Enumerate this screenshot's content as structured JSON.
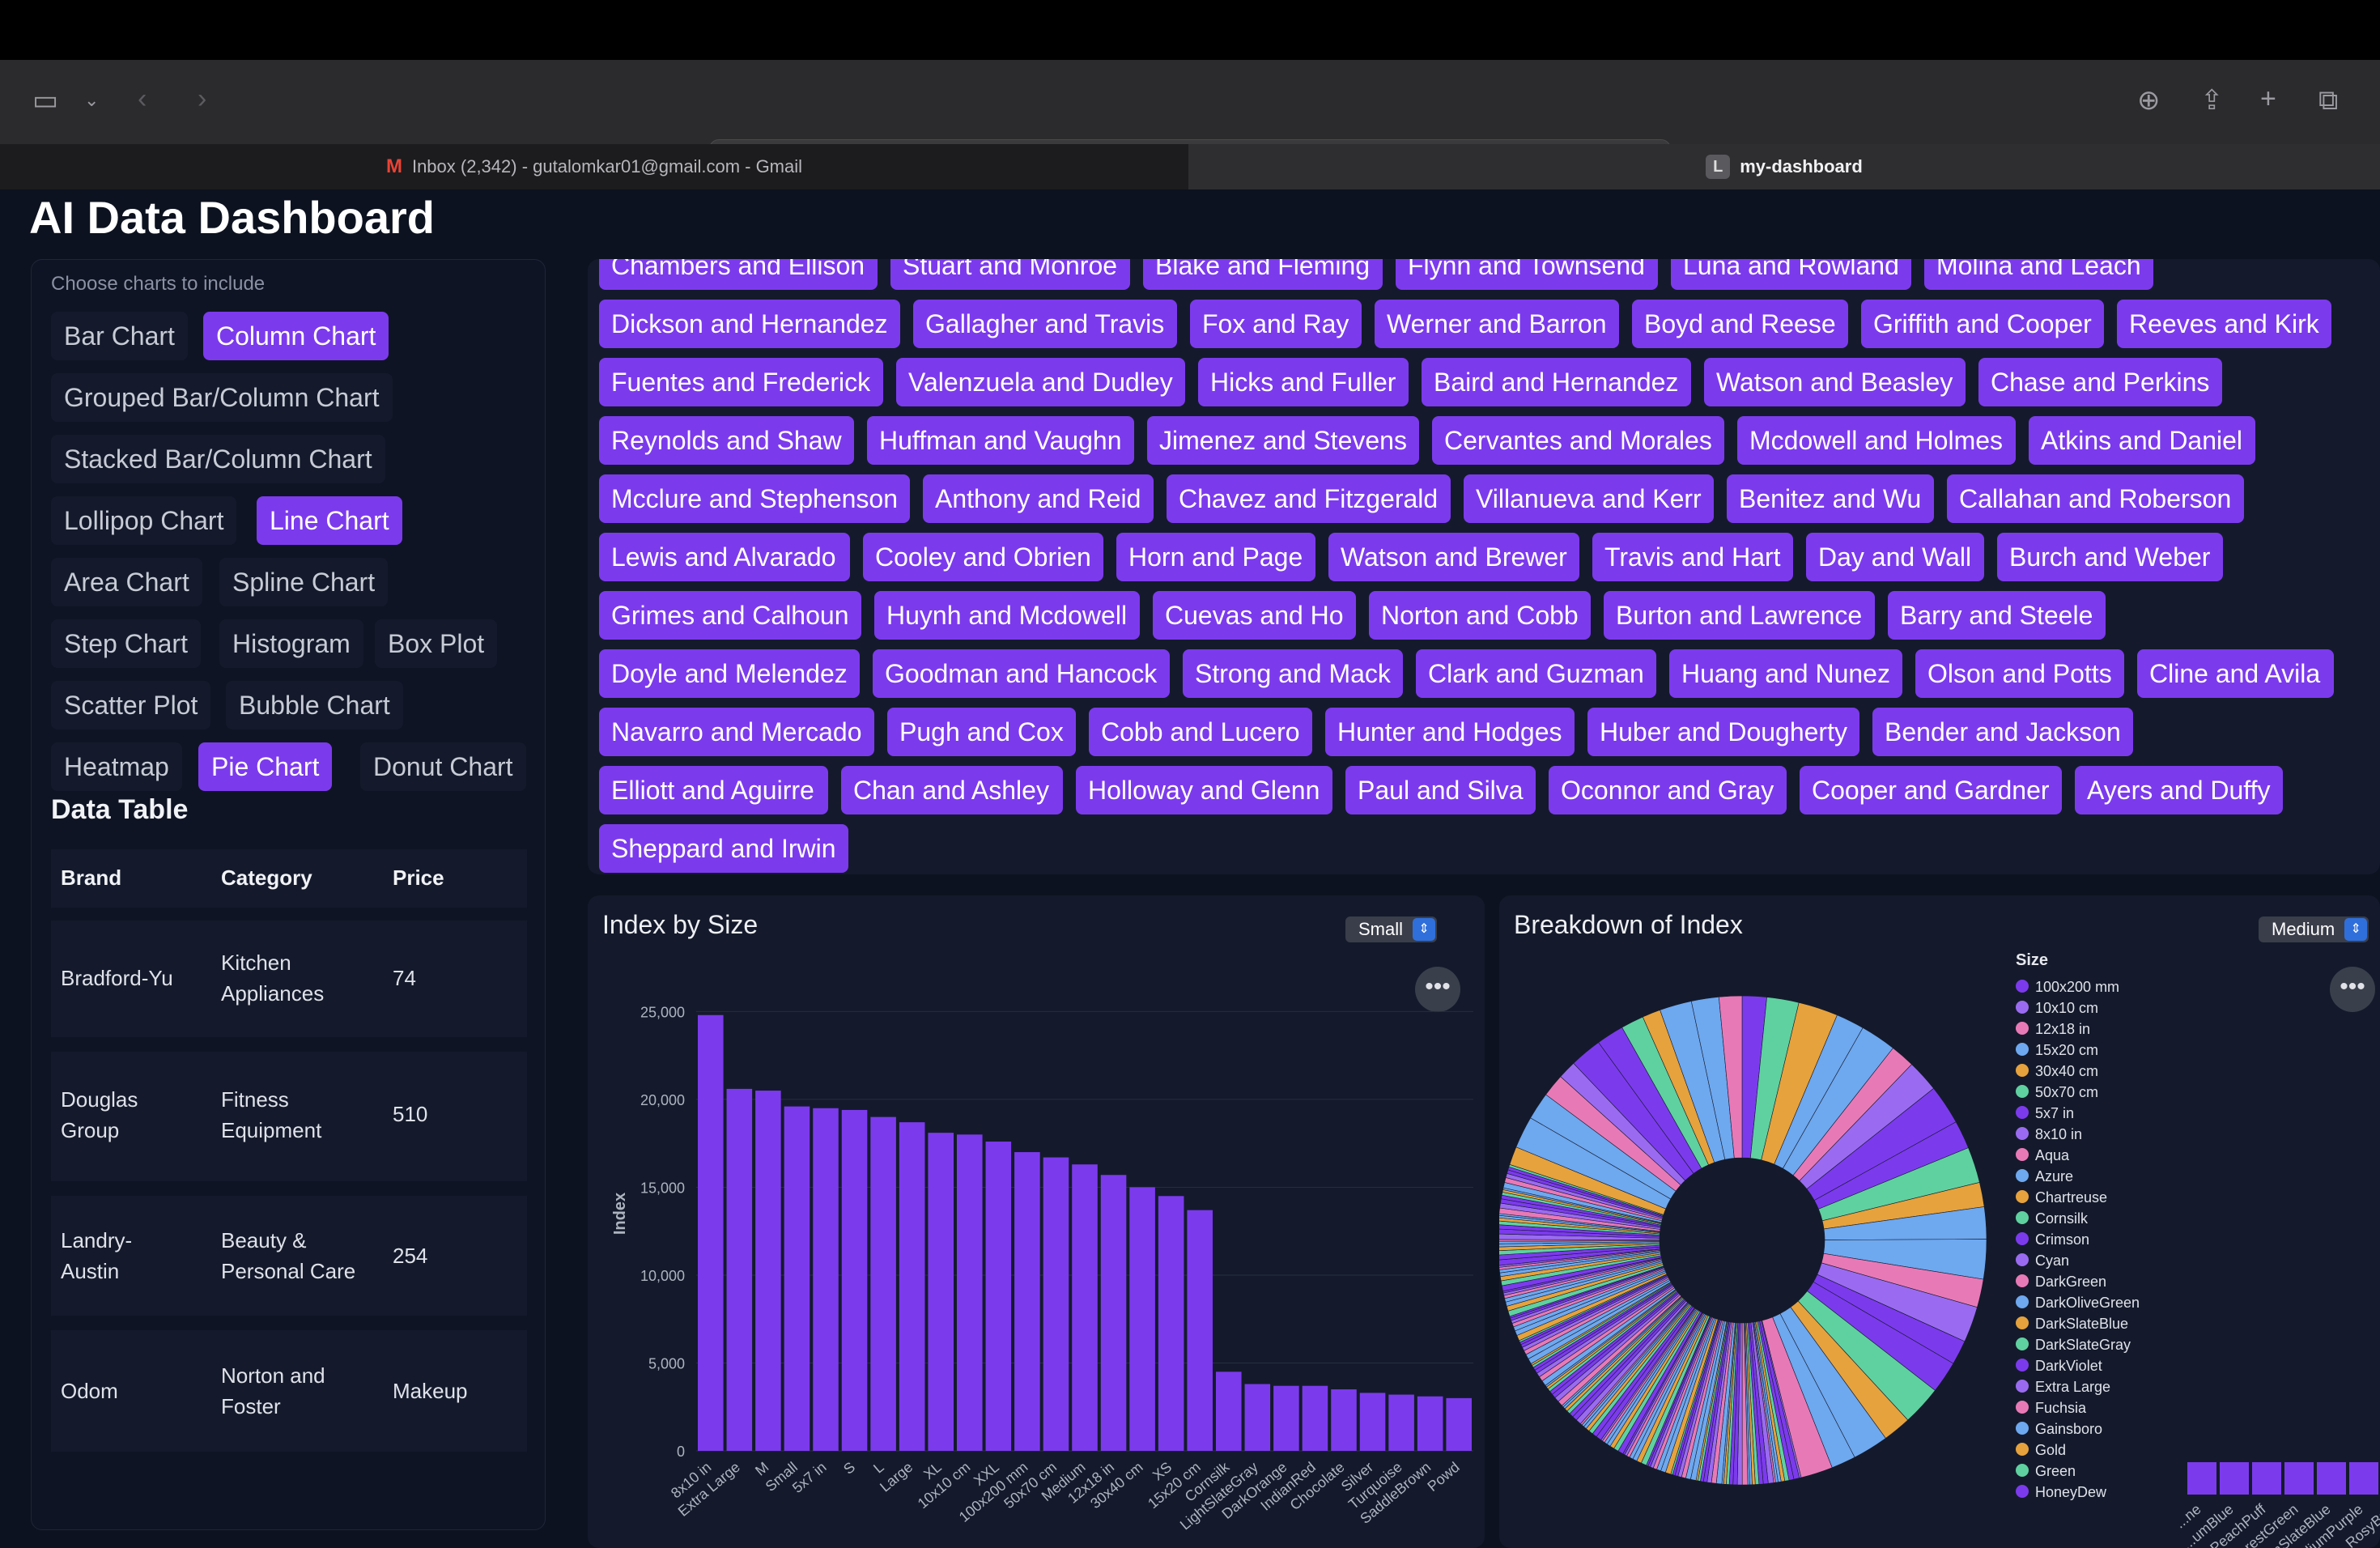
{
  "browser": {
    "url": "localhost",
    "tabs": [
      {
        "label": "Inbox (2,342) - gutalomkar01@gmail.com - Gmail",
        "icon": "gmail-icon"
      },
      {
        "label": "my-dashboard",
        "badge": "L"
      }
    ]
  },
  "page": {
    "title": "AI Data Dashboard",
    "chooser_label": "Choose charts to include"
  },
  "chart_options": [
    {
      "label": "Bar Chart",
      "selected": false
    },
    {
      "label": "Column Chart",
      "selected": true
    },
    {
      "label": "Grouped Bar/Column Chart",
      "selected": false
    },
    {
      "label": "Stacked Bar/Column Chart",
      "selected": false
    },
    {
      "label": "Lollipop Chart",
      "selected": false
    },
    {
      "label": "Line Chart",
      "selected": true
    },
    {
      "label": "Area Chart",
      "selected": false
    },
    {
      "label": "Spline Chart",
      "selected": false
    },
    {
      "label": "Step Chart",
      "selected": false
    },
    {
      "label": "Histogram",
      "selected": false
    },
    {
      "label": "Box Plot",
      "selected": false
    },
    {
      "label": "Scatter Plot",
      "selected": false
    },
    {
      "label": "Bubble Chart",
      "selected": false
    },
    {
      "label": "Heatmap",
      "selected": false
    },
    {
      "label": "Pie Chart",
      "selected": true
    },
    {
      "label": "Donut Chart",
      "selected": false
    }
  ],
  "data_table": {
    "title": "Data Table",
    "headers": [
      "Brand",
      "Category",
      "Price"
    ],
    "rows": [
      [
        "Bradford-Yu",
        "Kitchen Appliances",
        "74"
      ],
      [
        "Douglas Group",
        "Fitness Equipment",
        "510"
      ],
      [
        "Landry-Austin",
        "Beauty & Personal Care",
        "254"
      ],
      [
        "Odom",
        "Norton and Foster",
        "Makeup"
      ]
    ]
  },
  "tags": [
    [
      "Chambers and Ellison",
      "Stuart and Monroe",
      "Blake and Fleming",
      "Flynn and Townsend",
      "Luna and Rowland",
      "Molina and Leach"
    ],
    [
      "Dickson and Hernandez",
      "Gallagher and Travis",
      "Fox and Ray",
      "Werner and Barron",
      "Boyd and Reese",
      "Griffith and Cooper",
      "Reeves and Kirk"
    ],
    [
      "Fuentes and Frederick",
      "Valenzuela and Dudley",
      "Hicks and Fuller",
      "Baird and Hernandez",
      "Watson and Beasley",
      "Chase and Perkins"
    ],
    [
      "Reynolds and Shaw",
      "Huffman and Vaughn",
      "Jimenez and Stevens",
      "Cervantes and Morales",
      "Mcdowell and Holmes",
      "Atkins and Daniel"
    ],
    [
      "Mcclure and Stephenson",
      "Anthony and Reid",
      "Chavez and Fitzgerald",
      "Villanueva and Kerr",
      "Benitez and Wu",
      "Callahan and Roberson"
    ],
    [
      "Lewis and Alvarado",
      "Cooley and Obrien",
      "Horn and Page",
      "Watson and Brewer",
      "Travis and Hart",
      "Day and Wall",
      "Burch and Weber"
    ],
    [
      "Grimes and Calhoun",
      "Huynh and Mcdowell",
      "Cuevas and Ho",
      "Norton and Cobb",
      "Burton and Lawrence",
      "Barry and Steele"
    ],
    [
      "Doyle and Melendez",
      "Goodman and Hancock",
      "Strong and Mack",
      "Clark and Guzman",
      "Huang and Nunez",
      "Olson and Potts",
      "Cline and Avila"
    ],
    [
      "Navarro and Mercado",
      "Pugh and Cox",
      "Cobb and Lucero",
      "Hunter and Hodges",
      "Huber and Dougherty",
      "Bender and Jackson"
    ],
    [
      "Elliott and Aguirre",
      "Chan and Ashley",
      "Holloway and Glenn",
      "Paul and Silva",
      "Oconnor and Gray",
      "Cooper and Gardner",
      "Ayers and Duffy"
    ],
    [
      "Sheppard and Irwin"
    ]
  ],
  "colors": {
    "accent": "#7c3aed",
    "bar": "#7c3aed",
    "pie": [
      "#7c3aed",
      "#9a6bf0",
      "#e879b7",
      "#6ea8ef",
      "#e6a23c",
      "#5fd1a0"
    ]
  },
  "chart_data": [
    {
      "type": "bar",
      "title": "Index by Size",
      "selector": "Small",
      "ylabel": "Index",
      "xlabel": "",
      "ylim": [
        0,
        27000
      ],
      "yticks": [
        "0",
        "5,000",
        "10,000",
        "15,000",
        "20,000",
        "25,000"
      ],
      "categories": [
        "8x10 in",
        "Extra Large",
        "M",
        "Small",
        "5x7 in",
        "S",
        "L",
        "Large",
        "XL",
        "10x10 cm",
        "XXL",
        "100x200 mm",
        "50x70 cm",
        "Medium",
        "12x18 in",
        "30x40 cm",
        "XS",
        "15x20 cm",
        "Cornsilk",
        "LightSlateGray",
        "DarkOrange",
        "IndianRed",
        "Chocolate",
        "Silver",
        "Turquoise",
        "SaddleBrown",
        "Powd"
      ],
      "values": [
        24800,
        20600,
        20500,
        19600,
        19500,
        19400,
        19000,
        18700,
        18100,
        18000,
        17600,
        17000,
        16700,
        16300,
        15700,
        15000,
        14500,
        13700,
        4500,
        3800,
        3700,
        3700,
        3500,
        3300,
        3200,
        3100,
        3000
      ]
    },
    {
      "type": "pie",
      "title": "Breakdown of Index",
      "selector": "Medium",
      "legend_title": "Size",
      "legend": [
        "100x200 mm",
        "10x10 cm",
        "12x18 in",
        "15x20 cm",
        "30x40 cm",
        "50x70 cm",
        "5x7 in",
        "8x10 in",
        "Aqua",
        "Azure",
        "Chartreuse",
        "Cornsilk",
        "Crimson",
        "Cyan",
        "DarkGreen",
        "DarkOliveGreen",
        "DarkSlateBlue",
        "DarkSlateGray",
        "DarkViolet",
        "Extra Large",
        "Fuchsia",
        "Gainsboro",
        "Gold",
        "Green",
        "HoneyDew"
      ],
      "legend_placement": "right"
    },
    {
      "type": "bar",
      "title": "",
      "categories": [
        "...ne",
        "...umBlue",
        "PeachPuff",
        "ForestGreen",
        "...diumSlateBlue",
        "MediumPurple",
        "RosyBr...",
        "...mSpri..."
      ],
      "values": [
        1,
        1,
        1,
        1,
        1,
        1,
        1,
        1
      ]
    }
  ]
}
